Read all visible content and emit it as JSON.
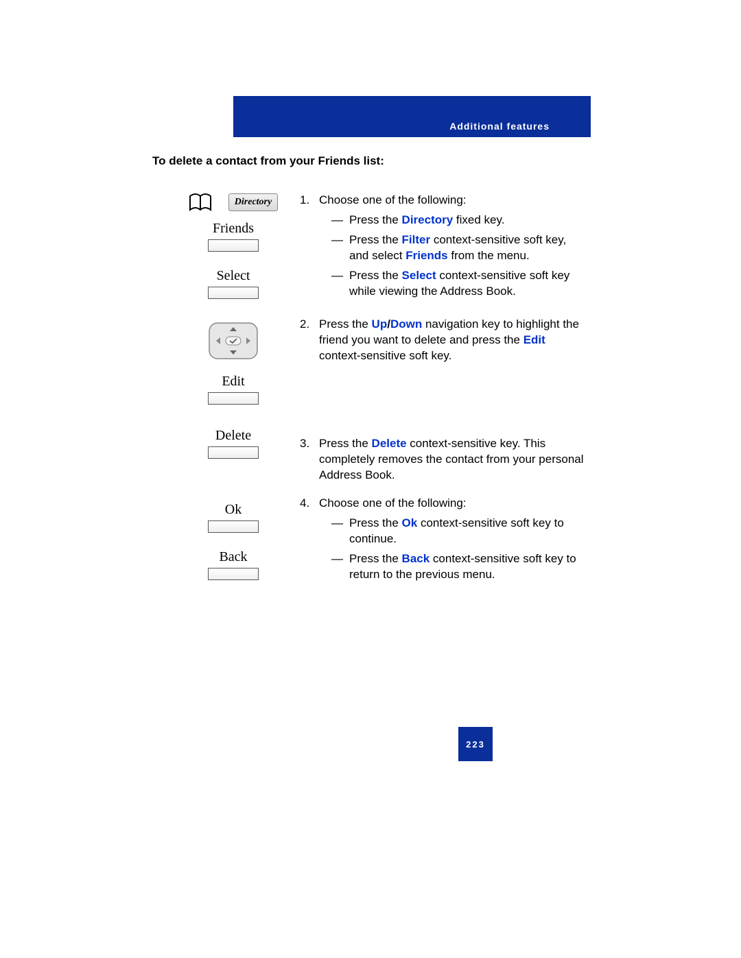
{
  "header": {
    "section_title": "Additional features"
  },
  "heading": "To delete a contact from your Friends list:",
  "keys": {
    "directory_label": "Directory",
    "friends": "Friends",
    "select": "Select",
    "edit": "Edit",
    "delete": "Delete",
    "ok": "Ok",
    "back": "Back"
  },
  "step1": {
    "num": "1.",
    "lead": "Choose one of the following:",
    "a": {
      "pre": "Press the ",
      "bold": "Directory",
      "post": " fixed key."
    },
    "b": {
      "pre": "Press the ",
      "bold1": "Filter",
      "mid": " context-sensitive soft key, and select ",
      "bold2": "Friends",
      "post": " from the menu."
    },
    "c": {
      "pre": "Press the ",
      "bold": "Select",
      "post": " context-sensitive soft key while viewing the Address Book."
    }
  },
  "step2": {
    "num": "2.",
    "pre": "Press the ",
    "bold1": "Up",
    "slash": "/",
    "bold2": "Down",
    "mid": " navigation key to highlight the friend you want to delete and press the ",
    "bold3": "Edit",
    "post": " context-sensitive soft key."
  },
  "step3": {
    "num": "3.",
    "pre": "Press the ",
    "bold": "Delete",
    "post": " context-sensitive key. This completely removes the contact from your personal Address Book."
  },
  "step4": {
    "num": "4.",
    "lead": "Choose one of the following:",
    "a": {
      "pre": "Press the ",
      "bold": "Ok",
      "post": " context-sensitive soft key to continue."
    },
    "b": {
      "pre": "Press the ",
      "bold": "Back",
      "post": " context-sensitive soft key to return to the previous menu."
    }
  },
  "page_number": "223"
}
